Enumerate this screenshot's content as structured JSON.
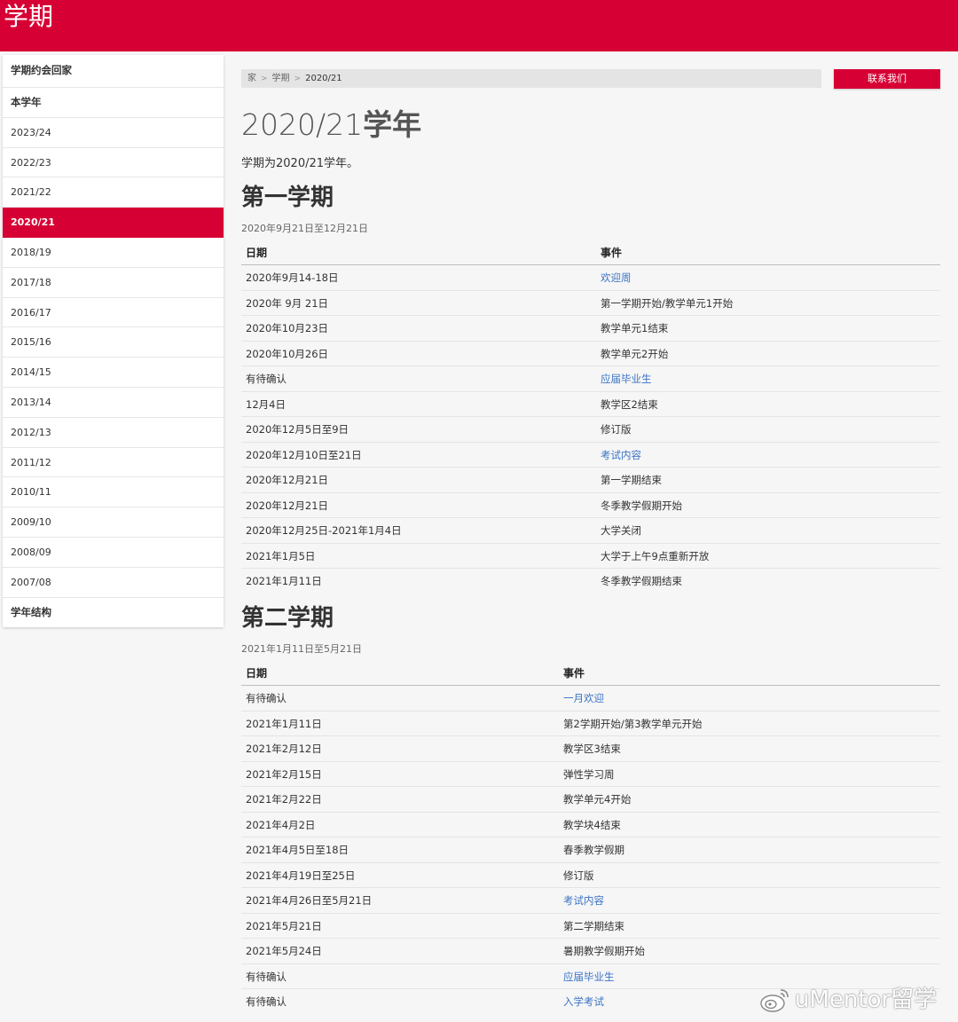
{
  "header": {
    "title": "学期"
  },
  "sidebar": {
    "items": [
      {
        "label": "学期约会回家",
        "style": "bold"
      },
      {
        "label": "本学年",
        "style": "bold"
      },
      {
        "label": "2023/24",
        "style": "normal"
      },
      {
        "label": "2022/23",
        "style": "normal"
      },
      {
        "label": "2021/22",
        "style": "normal"
      },
      {
        "label": "2020/21",
        "style": "active"
      },
      {
        "label": "2018/19",
        "style": "normal"
      },
      {
        "label": "2017/18",
        "style": "normal"
      },
      {
        "label": "2016/17",
        "style": "normal"
      },
      {
        "label": "2015/16",
        "style": "normal"
      },
      {
        "label": "2014/15",
        "style": "normal"
      },
      {
        "label": "2013/14",
        "style": "normal"
      },
      {
        "label": "2012/13",
        "style": "normal"
      },
      {
        "label": "2011/12",
        "style": "normal"
      },
      {
        "label": "2010/11",
        "style": "normal"
      },
      {
        "label": "2009/10",
        "style": "normal"
      },
      {
        "label": "2008/09",
        "style": "normal"
      },
      {
        "label": "2007/08",
        "style": "normal"
      },
      {
        "label": "学年结构",
        "style": "bold"
      }
    ]
  },
  "breadcrumb": {
    "home": "家",
    "section": "学期",
    "current": "2020/21",
    "separator": ">"
  },
  "contact_button": "联系我们",
  "page": {
    "title_year": "2020/21",
    "title_suffix": "学年",
    "intro": "学期为2020/21学年。"
  },
  "term1": {
    "title": "第一学期",
    "range": "2020年9月21日至12月21日",
    "col_date": "日期",
    "col_event": "事件",
    "rows": [
      {
        "date": "2020年9月14-18日",
        "event": "欢迎周",
        "link": true
      },
      {
        "date": "2020年 9月 21日",
        "event": "第一学期开始/教学单元1开始",
        "link": false
      },
      {
        "date": "2020年10月23日",
        "event": "教学单元1结束",
        "link": false
      },
      {
        "date": "2020年10月26日",
        "event": "教学单元2开始",
        "link": false
      },
      {
        "date": "有待确认",
        "event": "应届毕业生",
        "link": true
      },
      {
        "date": "12月4日",
        "event": "教学区2结束",
        "link": false
      },
      {
        "date": "2020年12月5日至9日",
        "event": "修订版",
        "link": false
      },
      {
        "date": "2020年12月10日至21日",
        "event": "考试内容",
        "link": true
      },
      {
        "date": "2020年12月21日",
        "event": "第一学期结束",
        "link": false
      },
      {
        "date": "2020年12月21日",
        "event": "冬季教学假期开始",
        "link": false
      },
      {
        "date": "2020年12月25日-2021年1月4日",
        "event": "大学关闭",
        "link": false
      },
      {
        "date": "2021年1月5日",
        "event": "大学于上午9点重新开放",
        "link": false
      },
      {
        "date": "2021年1月11日",
        "event": "冬季教学假期结束",
        "link": false
      }
    ]
  },
  "term2": {
    "title": "第二学期",
    "range": "2021年1月11日至5月21日",
    "col_date": "日期",
    "col_event": "事件",
    "rows": [
      {
        "date": "有待确认",
        "event": "一月欢迎",
        "link": true
      },
      {
        "date": "2021年1月11日",
        "event": "第2学期开始/第3教学单元开始",
        "link": false
      },
      {
        "date": "2021年2月12日",
        "event": "教学区3结束",
        "link": false
      },
      {
        "date": "2021年2月15日",
        "event": "弹性学习周",
        "link": false
      },
      {
        "date": "2021年2月22日",
        "event": "教学单元4开始",
        "link": false
      },
      {
        "date": "2021年4月2日",
        "event": "教学块4结束",
        "link": false
      },
      {
        "date": "2021年4月5日至18日",
        "event": "春季教学假期",
        "link": false
      },
      {
        "date": "2021年4月19日至25日",
        "event": "修订版",
        "link": false
      },
      {
        "date": "2021年4月26日至5月21日",
        "event": "考试内容",
        "link": true
      },
      {
        "date": "2021年5月21日",
        "event": "第二学期结束",
        "link": false
      },
      {
        "date": "2021年5月24日",
        "event": "暑期教学假期开始",
        "link": false
      },
      {
        "date": "有待确认",
        "event": "应届毕业生",
        "link": true
      },
      {
        "date": "有待确认",
        "event": "入学考试",
        "link": true
      }
    ]
  },
  "watermark": {
    "text": "uMentor留学",
    "icon": "weibo-icon"
  },
  "colors": {
    "brand": "#d60034",
    "link": "#3b73c4",
    "background": "#f6f6f6"
  }
}
